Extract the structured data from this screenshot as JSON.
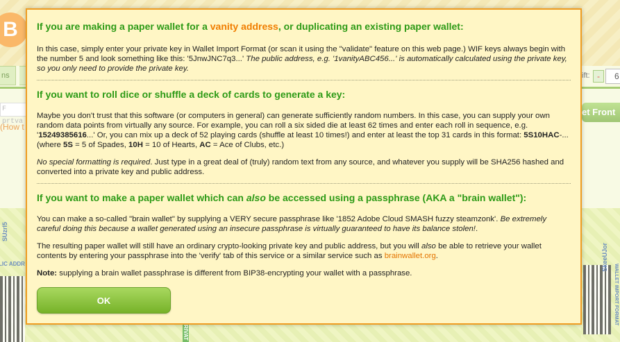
{
  "background": {
    "logo_glyph": "B",
    "tab_left_label": "ns",
    "passphrase_placeholder": "F prtva",
    "howto_link": "(How t",
    "shift_label": "ift:",
    "minus_button": "-",
    "count_value": "6",
    "front_button": "et Front",
    "left_wallet_vertical_text": "SUzrl5",
    "left_wallet_addr_text": "LIC ADDR",
    "right_wallet_vertical_text": "SkeeUJor",
    "right_wallet_format_text": "WALLET IMPORT FORMAT",
    "middle_strip_text": "RIVAT"
  },
  "modal": {
    "section1": {
      "title_prefix": "If you are making a paper wallet for a ",
      "title_link": "vanity address",
      "title_suffix": ", or duplicating an existing paper wallet:",
      "body_plain": "In this case, simply enter your private key in Wallet Import Format (or scan it using the \"validate\" feature on this web page.) WIF keys always begin with the number 5 and look something like this: '5JnwJNC7q3...'",
      "body_italic": " The public address, e.g. '1vanityABC456...' is automatically calculated using the private key, so you only need to provide the private key."
    },
    "section2": {
      "title": "If you want to roll dice or shuffle a deck of cards to generate a key:",
      "body1_a": "Maybe you don't trust that this software (or computers in general) can generate sufficiently random numbers. In this case, you can supply your own random data points from virtually any source. For example, you can roll a six sided die at least 62 times and enter each roll in sequence, e.g. '",
      "body1_b": "15249385616",
      "body1_c": "...' Or, you can mix up a deck of 52 playing cards (shuffle at least 10 times!) and enter at least the top 31 cards in this format: ",
      "body1_d": "5S10HAC",
      "body1_e": "-... (where ",
      "body1_f": "5S",
      "body1_g": " = 5 of Spades, ",
      "body1_h": "10H",
      "body1_i": " = 10 of Hearts, ",
      "body1_j": "AC",
      "body1_k": " = Ace of Clubs, etc.)",
      "body2_italic": "No special formatting is required",
      "body2_rest": ". Just type in a great deal of (truly) random text from any source, and whatever you supply will be SHA256 hashed and converted into a private key and public address."
    },
    "section3": {
      "title_a": "If you want to make a paper wallet which can ",
      "title_b": "also",
      "title_c": " be accessed using a passphrase (AKA a \"brain wallet\"):",
      "body1_a": "You can make a so-called \"brain wallet\" by supplying a VERY secure passphrase like '1852 Adobe Cloud SMASH fuzzy steamzonk'. ",
      "body1_italic": "Be extremely careful doing this because a wallet generated using an insecure passphrase is virtually guaranteed to have its balance stolen!",
      "body1_end": ".",
      "body2_a": "The resulting paper wallet will still have an ordinary crypto-looking private key and public address, but you will ",
      "body2_b": "also",
      "body2_c": " be able to retrieve your wallet contents by entering your passphrase into the 'verify' tab of this service or a similar service such as ",
      "body2_link": "brainwallet.org",
      "body2_d": ".",
      "note_label": "Note:",
      "note_text": " supplying a brain wallet passphrase is different from BIP38-encrypting your wallet with a passphrase."
    },
    "ok_label": "OK"
  },
  "colors": {
    "heading_green": "#2d9a16",
    "link_orange": "#f07d00",
    "modal_bg": "#fff6c5",
    "modal_border": "#ef9d22",
    "button_green": "#77b229"
  }
}
